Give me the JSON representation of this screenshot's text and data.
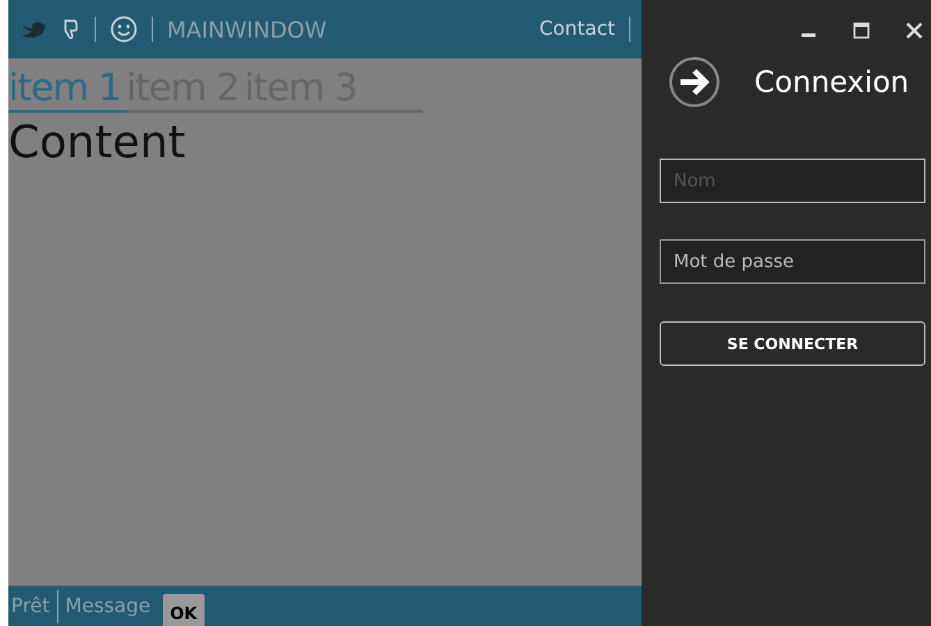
{
  "toolbar": {
    "title": "MAINWINDOW",
    "links": [
      "Contact"
    ]
  },
  "tabs": [
    {
      "label": "item 1",
      "selected": true
    },
    {
      "label": "item 2",
      "selected": false
    },
    {
      "label": "item 3",
      "selected": false
    }
  ],
  "content": "Content",
  "status_bar": {
    "items": [
      "Prêt",
      "Message"
    ],
    "button": "OK"
  },
  "login": {
    "title": "Connexion",
    "name_field": {
      "placeholder": "Nom"
    },
    "password_field": {
      "value": "Mot de passe"
    },
    "button": "SE CONNECTER"
  }
}
